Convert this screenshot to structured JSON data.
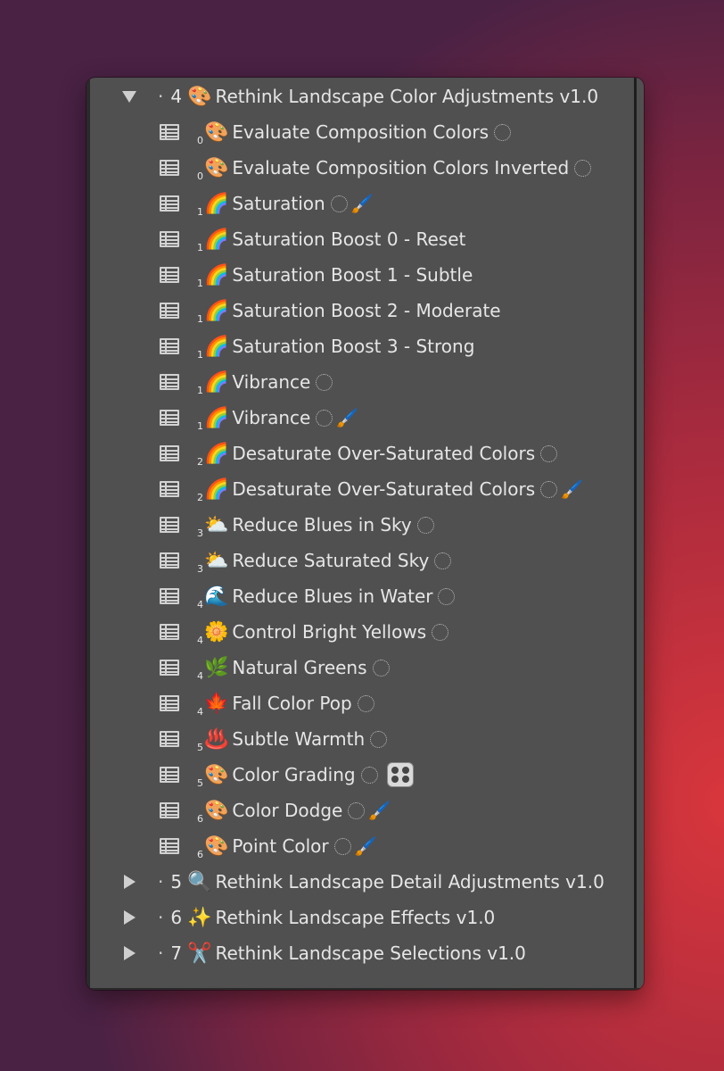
{
  "groups": [
    {
      "number": "4",
      "emoji": "🎨",
      "title": "Rethink Landscape Color Adjustments v1.0",
      "expanded": true
    },
    {
      "number": "5",
      "emoji": "🔍",
      "title": "Rethink Landscape Detail Adjustments v1.0",
      "expanded": false
    },
    {
      "number": "6",
      "emoji": "✨",
      "title": "Rethink Landscape Effects v1.0",
      "expanded": false
    },
    {
      "number": "7",
      "emoji": "✂️",
      "title": "Rethink Landscape Selections v1.0",
      "expanded": false
    }
  ],
  "separator": "·",
  "presets": [
    {
      "sub": "0",
      "emoji": "🎨",
      "label": "Evaluate Composition Colors",
      "circle": true,
      "brush": false,
      "grid": false
    },
    {
      "sub": "0",
      "emoji": "🎨",
      "label": "Evaluate Composition Colors Inverted",
      "circle": true,
      "brush": false,
      "grid": false
    },
    {
      "sub": "1",
      "emoji": "🌈",
      "label": "Saturation",
      "circle": true,
      "brush": true,
      "grid": false
    },
    {
      "sub": "1",
      "emoji": "🌈",
      "label": "Saturation Boost 0 - Reset",
      "circle": false,
      "brush": false,
      "grid": false
    },
    {
      "sub": "1",
      "emoji": "🌈",
      "label": "Saturation Boost 1 - Subtle",
      "circle": false,
      "brush": false,
      "grid": false
    },
    {
      "sub": "1",
      "emoji": "🌈",
      "label": "Saturation Boost 2 - Moderate",
      "circle": false,
      "brush": false,
      "grid": false
    },
    {
      "sub": "1",
      "emoji": "🌈",
      "label": "Saturation Boost 3 - Strong",
      "circle": false,
      "brush": false,
      "grid": false
    },
    {
      "sub": "1",
      "emoji": "🌈",
      "label": "Vibrance",
      "circle": true,
      "brush": false,
      "grid": false
    },
    {
      "sub": "1",
      "emoji": "🌈",
      "label": "Vibrance",
      "circle": true,
      "brush": true,
      "grid": false
    },
    {
      "sub": "2",
      "emoji": "🌈",
      "label": "Desaturate Over-Saturated Colors",
      "circle": true,
      "brush": false,
      "grid": false
    },
    {
      "sub": "2",
      "emoji": "🌈",
      "label": "Desaturate Over-Saturated Colors",
      "circle": true,
      "brush": true,
      "grid": false
    },
    {
      "sub": "3",
      "emoji": "⛅",
      "label": "Reduce Blues in Sky",
      "circle": true,
      "brush": false,
      "grid": false
    },
    {
      "sub": "3",
      "emoji": "⛅",
      "label": "Reduce Saturated Sky",
      "circle": true,
      "brush": false,
      "grid": false
    },
    {
      "sub": "4",
      "emoji": "🌊",
      "label": "Reduce Blues in Water",
      "circle": true,
      "brush": false,
      "grid": false
    },
    {
      "sub": "4",
      "emoji": "🌼",
      "label": "Control Bright Yellows",
      "circle": true,
      "brush": false,
      "grid": false
    },
    {
      "sub": "4",
      "emoji": "🌿",
      "label": "Natural Greens",
      "circle": true,
      "brush": false,
      "grid": false
    },
    {
      "sub": "4",
      "emoji": "🍁",
      "label": "Fall Color Pop",
      "circle": true,
      "brush": false,
      "grid": false
    },
    {
      "sub": "5",
      "emoji": "♨️",
      "label": "Subtle Warmth",
      "circle": true,
      "brush": false,
      "grid": false
    },
    {
      "sub": "5",
      "emoji": "🎨",
      "label": "Color Grading",
      "circle": true,
      "brush": false,
      "grid": true
    },
    {
      "sub": "6",
      "emoji": "🎨",
      "label": "Color Dodge",
      "circle": true,
      "brush": true,
      "grid": false
    },
    {
      "sub": "6",
      "emoji": "🎨",
      "label": "Point Color",
      "circle": true,
      "brush": true,
      "grid": false
    }
  ],
  "brush_emoji": "🖌️",
  "colors": {
    "panel_bg": "#505050",
    "text": "#e6e6e6"
  }
}
